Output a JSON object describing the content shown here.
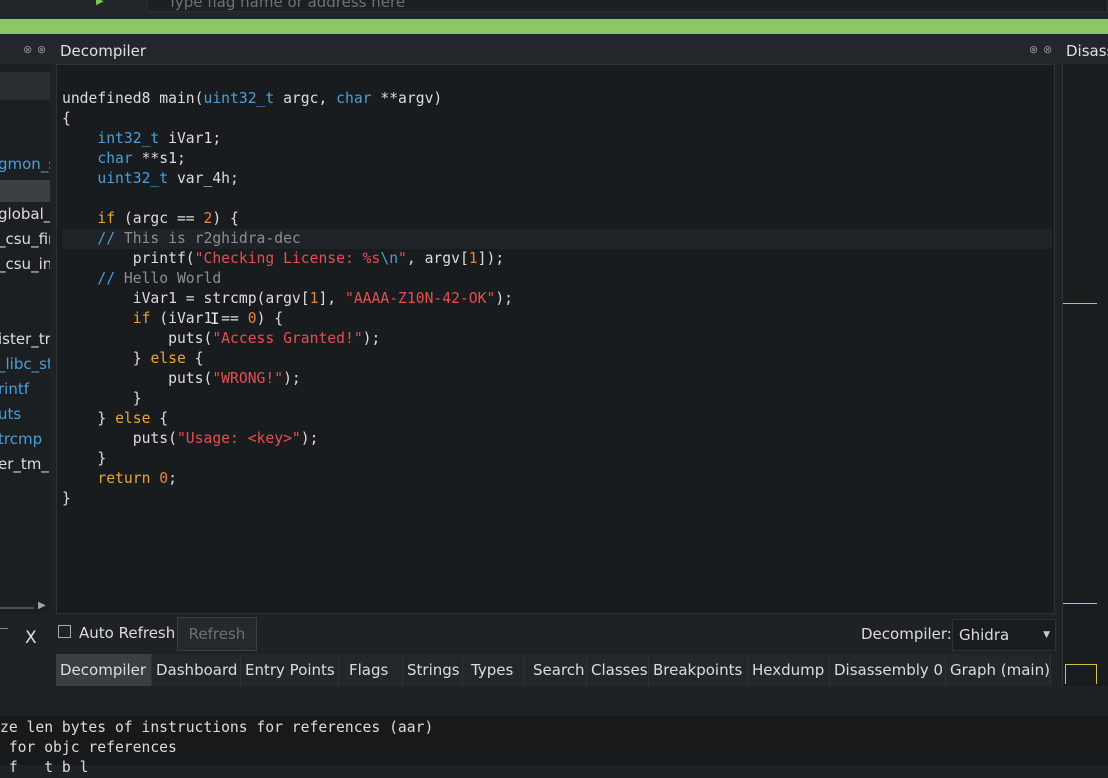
{
  "toolbar": {
    "flag_placeholder": "Type flag name or address here"
  },
  "decompiler": {
    "title": "Decompiler",
    "code": {
      "sig_ret": "undefined8 main(",
      "t_uint32": "uint32_t",
      "sig_argc": " argc, ",
      "t_char": "char",
      "sig_argv": " **argv)",
      "brace_open": "{",
      "t_int32": "int32_t",
      "decl_ivar1": " iVar1;",
      "decl_s1": " **s1;",
      "decl_var4h": " var_4h;",
      "kw_if": "if",
      "cond1_a": " (argc == ",
      "num_2": "2",
      "cond1_b": ") {",
      "comment_slashes": "//",
      "comment1": " This is r2ghidra-dec",
      "printf_a": "printf(",
      "str_checking": "\"Checking License: %s",
      "esc_n": "\\n",
      "quote": "\"",
      "printf_b": ", argv[",
      "num_1": "1",
      "printf_c": "]);",
      "comment2": " Hello World",
      "strcmp_a": "iVar1 = strcmp(argv[",
      "strcmp_b": "], ",
      "str_key": "\"AAAA-Z10N-42-OK\"",
      "strcmp_c": ");",
      "cond2_a": " (iVar1 == ",
      "num_0": "0",
      "cond2_b": ") {",
      "puts_a": "puts(",
      "str_granted": "\"Access Granted!\"",
      "puts_end": ");",
      "close_brace": "} ",
      "kw_else": "else",
      "open_brace": " {",
      "str_wrong": "\"WRONG!\"",
      "brace_close": "}",
      "str_usage": "\"Usage: <key>\"",
      "kw_return": "return",
      "ret_end": ";",
      "ret_space": " "
    }
  },
  "left_panel": {
    "items": [
      "gmon_s",
      "global_",
      "_csu_fir",
      "_csu_in",
      "ister_tr",
      "_libc_st",
      "rintf",
      "uts",
      "trcmp",
      "er_tm_"
    ],
    "close_label": "X"
  },
  "right_panel": {
    "title": "Disass"
  },
  "controls": {
    "auto_refresh_label": "Auto Refresh",
    "refresh_label": "Refresh",
    "decompiler_label": "Decompiler:",
    "decompiler_value": "Ghidra"
  },
  "tabs": [
    "Decompiler",
    "Dashboard",
    "Entry Points",
    "Flags",
    "Strings",
    "Types",
    "Search",
    "Classes",
    "Breakpoints",
    "Hexdump",
    "Disassembly 0",
    "Graph (main)"
  ],
  "console": {
    "lines": [
      "ze len bytes of instructions for references (aar)",
      " for objc references",
      " f   t b l"
    ]
  },
  "colors": {
    "accent_green": "#8cc864",
    "type_blue": "#4a9fd8",
    "string_red": "#e44f4f",
    "number_orange": "#e8843c",
    "keyword_amber": "#e8a43c"
  }
}
